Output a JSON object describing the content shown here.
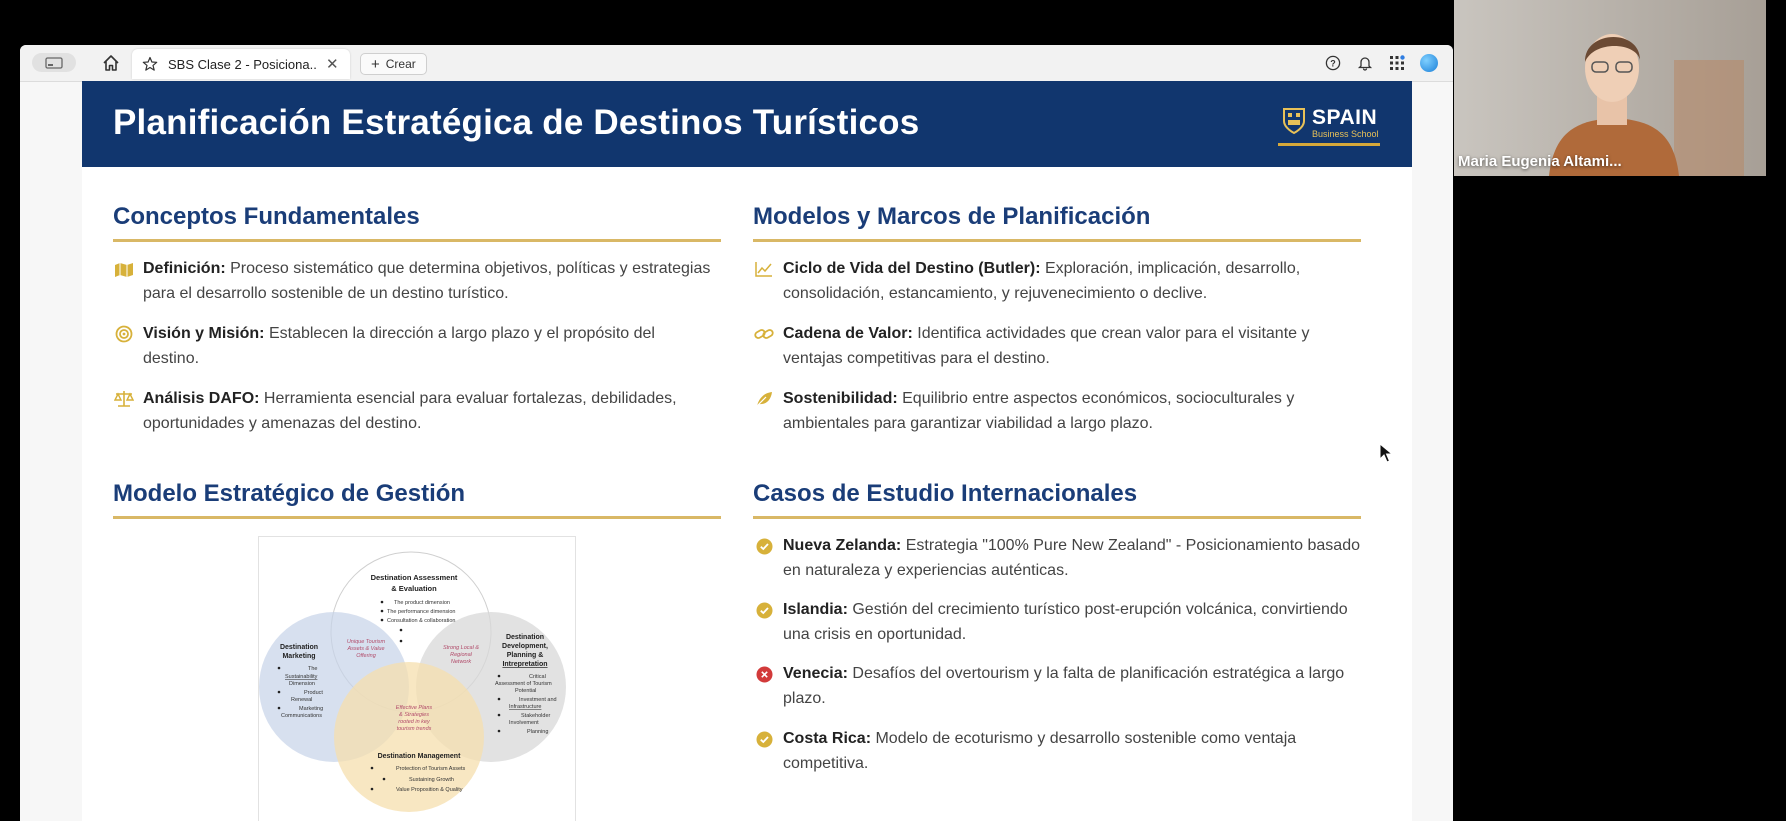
{
  "browser": {
    "tab_title": "SBS Clase 2 - Posiciona...",
    "tab_close": "✕",
    "new_tab_label": "Crear"
  },
  "slide": {
    "title": "Planificación Estratégica de Destinos Turísticos",
    "logo_brand": "SPAIN",
    "logo_sub": "Business School",
    "sections": {
      "conceptos": {
        "title": "Conceptos Fundamentales",
        "items": [
          {
            "label": "Definición:",
            "text": " Proceso sistemático que determina objetivos, políticas y estrategias para el desarrollo sostenible de un destino turístico.",
            "icon": "map-icon"
          },
          {
            "label": "Visión y Misión:",
            "text": " Establecen la dirección a largo plazo y el propósito del destino.",
            "icon": "target-icon"
          },
          {
            "label": "Análisis DAFO:",
            "text": " Herramienta esencial para evaluar fortalezas, debilidades, oportunidades y amenazas del destino.",
            "icon": "balance-icon"
          }
        ]
      },
      "modelos": {
        "title": "Modelos y Marcos de Planificación",
        "items": [
          {
            "label": "Ciclo de Vida del Destino (Butler):",
            "text": " Exploración, implicación, desarrollo, consolidación, estancamiento, y rejuvenecimiento o declive.",
            "icon": "line-chart-icon"
          },
          {
            "label": "Cadena de Valor:",
            "text": " Identifica actividades que crean valor para el visitante y ventajas competitivas para el destino.",
            "icon": "link-icon"
          },
          {
            "label": "Sostenibilidad:",
            "text": " Equilibrio entre aspectos económicos, socioculturales y ambientales para garantizar viabilidad a largo plazo.",
            "icon": "leaf-icon"
          }
        ]
      },
      "modelo_estrategico": {
        "title": "Modelo Estratégico de Gestión"
      },
      "casos": {
        "title": "Casos de Estudio Internacionales",
        "items": [
          {
            "label": "Nueva Zelanda:",
            "text": " Estrategia \"100% Pure New Zealand\" - Posicionamiento basado en naturaleza y experiencias auténticas.",
            "icon": "check-icon"
          },
          {
            "label": "Islandia:",
            "text": " Gestión del crecimiento turístico post-erupción volcánica, convirtiendo una crisis en oportunidad.",
            "icon": "check-icon"
          },
          {
            "label": "Venecia:",
            "text": " Desafíos del overtourism y la falta de planificación estratégica a largo plazo.",
            "icon": "x-icon"
          },
          {
            "label": "Costa Rica:",
            "text": " Modelo de ecoturismo y desarrollo sostenible como ventaja competitiva.",
            "icon": "check-icon"
          }
        ]
      }
    },
    "diagram": {
      "top_title_1": "Destination Assessment",
      "top_title_2": "& Evaluation",
      "top_bullets": [
        "The product dimension",
        "The performance dimension",
        "Consultation & collaboration"
      ],
      "left_title_1": "Destination",
      "left_title_2": "Marketing",
      "left_bullets": [
        "The",
        "Sustainability",
        "Dimension",
        "Product",
        "Renewal",
        "Marketing",
        "Communications"
      ],
      "right_title_1": "Destination",
      "right_title_2": "Development,",
      "right_title_3": "Planning &",
      "right_title_4": "Intrepretation",
      "right_bullets": [
        "Critical",
        "Assessment of Tourism",
        "Potential",
        "Investment and",
        "Infrastructure",
        "Stakeholder",
        "Involvement",
        "Planning"
      ],
      "bottom_title": "Destination Management",
      "bottom_bullets": [
        "Protection of Tourism Assets",
        "Sustaining Growth",
        "Value Proposition & Quality"
      ],
      "overlap_1": [
        "Unique Tourism",
        "Assets & Value",
        "Offering"
      ],
      "overlap_2": [
        "Strong Local &",
        "Regional",
        "Network"
      ],
      "overlap_3": [
        "Effective Plans",
        "& Strategies",
        "rooted in key",
        "tourism trends"
      ]
    }
  },
  "video": {
    "participant_name": "Maria Eugenia Altami..."
  },
  "colors": {
    "header_bg": "#11366e",
    "section_title": "#1a3d78",
    "rule": "#d9b866",
    "check": "#d7b13a",
    "x": "#d23a3a"
  }
}
